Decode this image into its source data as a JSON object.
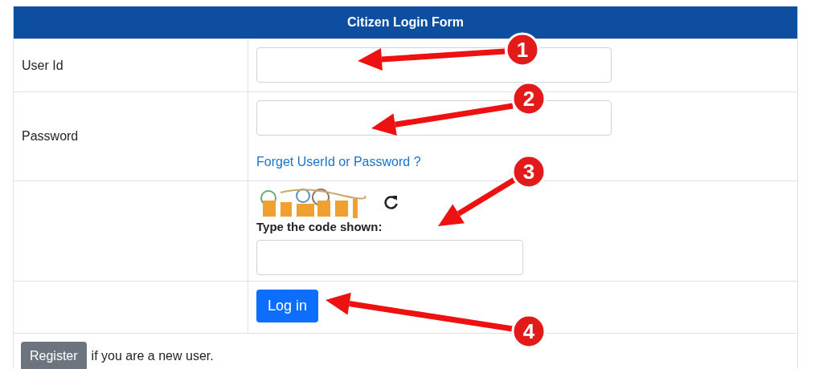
{
  "form": {
    "title": "Citizen Login Form",
    "user_id": {
      "label": "User Id"
    },
    "password": {
      "label": "Password",
      "link": "Forget UserId or Password ?"
    },
    "captcha": {
      "label": "Type the code shown:"
    },
    "login_button": "Log in",
    "register": {
      "button": "Register",
      "text": "if you are a new user."
    }
  },
  "annotations": [
    {
      "number": "1"
    },
    {
      "number": "2"
    },
    {
      "number": "3"
    },
    {
      "number": "4"
    }
  ]
}
